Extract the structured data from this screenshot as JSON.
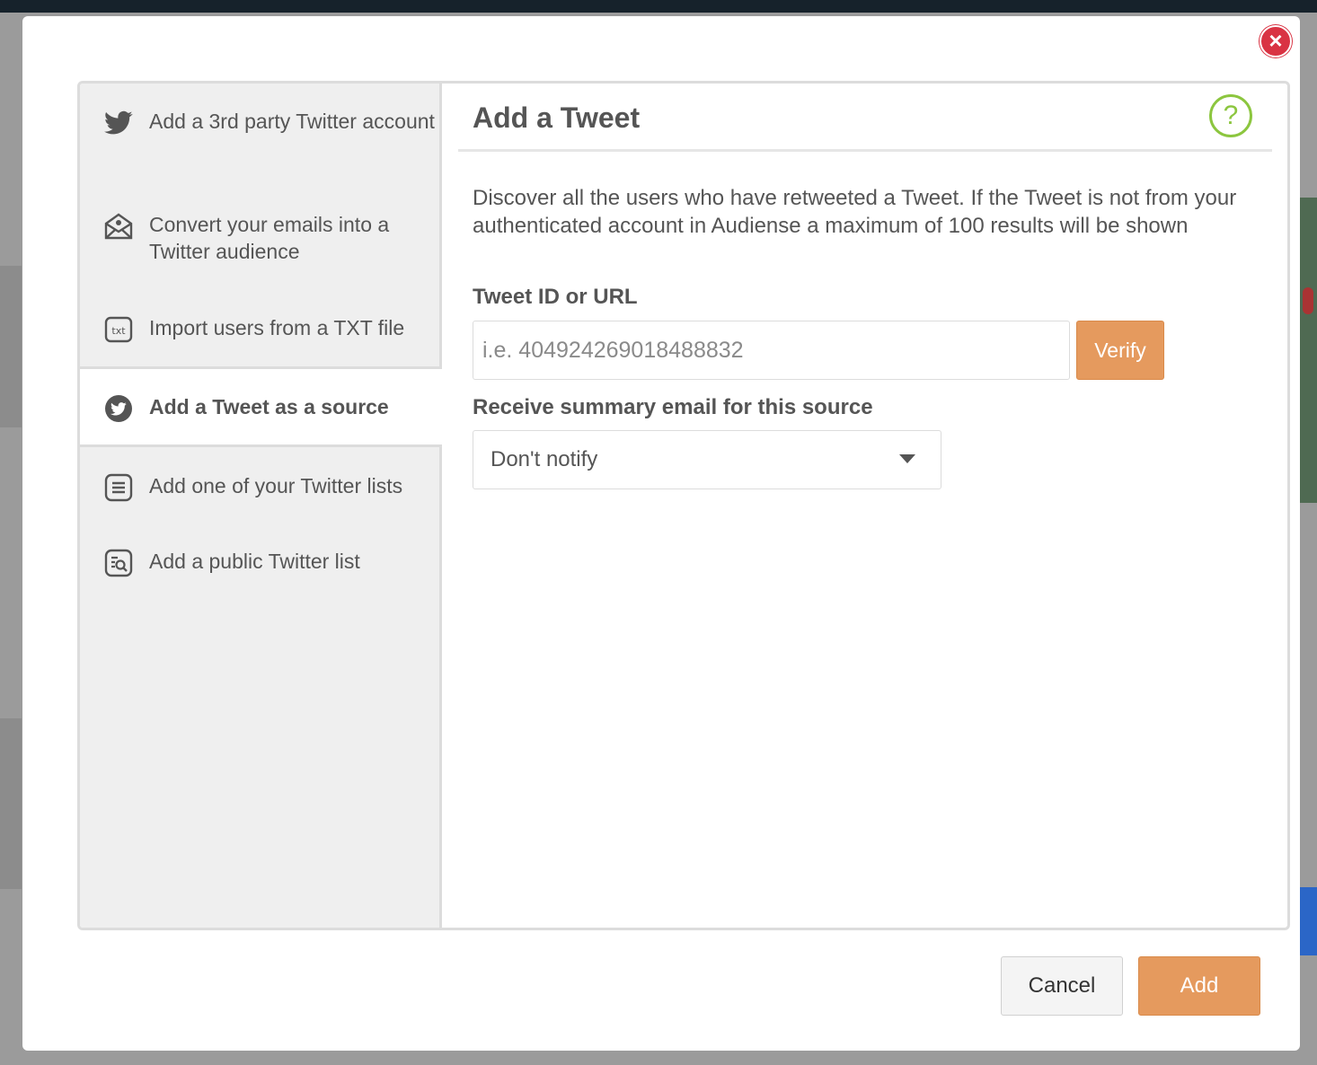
{
  "modal": {
    "close_label": "×",
    "sidebar": {
      "items": [
        {
          "label": "Add a 3rd party Twitter account",
          "icon": "twitter-bird-icon"
        },
        {
          "label": "Convert your emails into a Twitter audience",
          "icon": "envelope-icon"
        },
        {
          "label": "Import users from a TXT file",
          "icon": "txt-file-icon"
        },
        {
          "label": "Add a Tweet as a source",
          "icon": "twitter-circle-icon",
          "active": true
        },
        {
          "label": "Add one of your Twitter lists",
          "icon": "list-icon"
        },
        {
          "label": "Add a public Twitter list",
          "icon": "search-list-icon"
        }
      ]
    },
    "content": {
      "title": "Add a Tweet",
      "help_label": "?",
      "description": "Discover all the users who have retweeted a Tweet. If the Tweet is not from your authenticated account in Audiense a maximum of 100 results will be shown",
      "tweet_field": {
        "label": "Tweet ID or URL",
        "placeholder": "i.e. 404924269018488832",
        "value": ""
      },
      "verify_label": "Verify",
      "summary_field": {
        "label": "Receive summary email for this source",
        "selected": "Don't notify"
      }
    },
    "footer": {
      "cancel_label": "Cancel",
      "add_label": "Add"
    }
  },
  "colors": {
    "accent": "#e59a5e",
    "close": "#d93343",
    "help": "#8cc63f"
  }
}
